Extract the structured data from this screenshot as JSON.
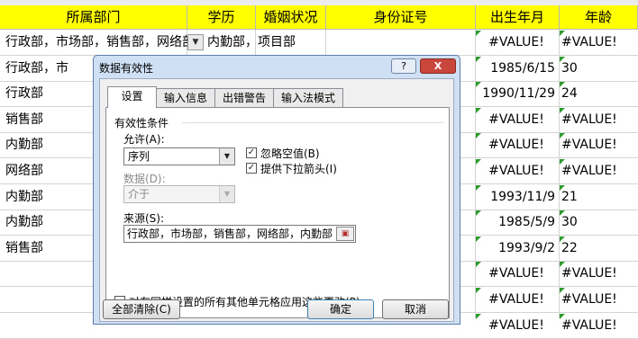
{
  "headers": {
    "dept": "所属部门",
    "edu": "学历",
    "marital": "婚姻状况",
    "idcard": "身份证号",
    "birth": "出生年月",
    "age": "年龄"
  },
  "rows": [
    {
      "dept": "行政部，市场部，销售部，网络部，内勤部，项目部",
      "birth": "#VALUE!",
      "age": "#VALUE!"
    },
    {
      "dept": "行政部，市",
      "birth": "1985/6/15",
      "age": "30"
    },
    {
      "dept": "行政部",
      "birth": "1990/11/29",
      "age": "24"
    },
    {
      "dept": "销售部",
      "birth": "#VALUE!",
      "age": "#VALUE!"
    },
    {
      "dept": "内勤部",
      "birth": "#VALUE!",
      "age": "#VALUE!"
    },
    {
      "dept": "网络部",
      "birth": "#VALUE!",
      "age": "#VALUE!"
    },
    {
      "dept": "内勤部",
      "birth": "1993/11/9",
      "age": "21"
    },
    {
      "dept": "内勤部",
      "birth": "1985/5/9",
      "age": "30"
    },
    {
      "dept": "销售部",
      "birth": "1993/9/2",
      "age": "22"
    },
    {
      "dept": "",
      "birth": "#VALUE!",
      "age": "#VALUE!"
    },
    {
      "dept": "",
      "birth": "#VALUE!",
      "age": "#VALUE!"
    },
    {
      "dept": "",
      "birth": "#VALUE!",
      "age": "#VALUE!"
    }
  ],
  "dialog": {
    "title": "数据有效性",
    "help_label": "?",
    "close_label": "X",
    "tabs": [
      "设置",
      "输入信息",
      "出错警告",
      "输入法模式"
    ],
    "section_title": "有效性条件",
    "allow_label": "允许(A):",
    "allow_value": "序列",
    "data_label": "数据(D):",
    "data_value": "介于",
    "ignore_blank_label": "忽略空值(B)",
    "dropdown_label": "提供下拉箭头(I)",
    "source_label": "来源(S):",
    "source_value": "行政部，市场部，销售部，网络部，内勤部",
    "apply_all_label": "对有同样设置的所有其他单元格应用这些更改(P)",
    "clear_all_label": "全部清除(C)",
    "ok_label": "确定",
    "cancel_label": "取消",
    "ignore_blank_checked": true,
    "dropdown_checked": true,
    "apply_all_checked": false
  },
  "colors": {
    "header_bg": "#ffff00",
    "dialog_frame": "#cfe0f5",
    "error_marker": "#2e9b2e"
  }
}
